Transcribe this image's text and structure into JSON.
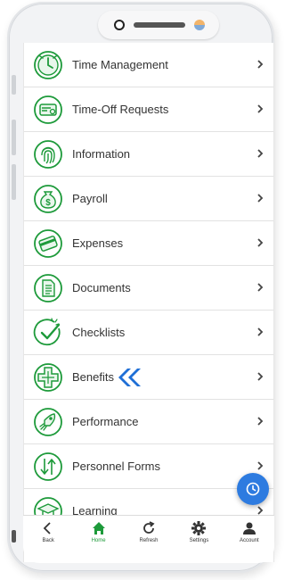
{
  "colors": {
    "accent_green": "#1d9a3a",
    "fab_blue": "#2d7be0",
    "marker_blue": "#1f6fd6"
  },
  "menu": {
    "items": [
      {
        "label": "Time Management",
        "icon": "clock-icon"
      },
      {
        "label": "Time-Off Requests",
        "icon": "ticket-icon"
      },
      {
        "label": "Information",
        "icon": "fingerprint-icon"
      },
      {
        "label": "Payroll",
        "icon": "money-bag-icon"
      },
      {
        "label": "Expenses",
        "icon": "credit-card-icon"
      },
      {
        "label": "Documents",
        "icon": "document-icon"
      },
      {
        "label": "Checklists",
        "icon": "checkmark-icon"
      },
      {
        "label": "Benefits",
        "icon": "medical-cross-icon"
      },
      {
        "label": "Performance",
        "icon": "rocket-icon"
      },
      {
        "label": "Personnel Forms",
        "icon": "arrows-icon"
      },
      {
        "label": "Learning",
        "icon": "graduation-icon"
      }
    ]
  },
  "fab": {
    "icon": "clock-icon"
  },
  "bottom_nav": {
    "items": [
      {
        "label": "Back",
        "icon": "chevron-left-icon"
      },
      {
        "label": "Home",
        "icon": "home-icon",
        "active": true
      },
      {
        "label": "Refresh",
        "icon": "refresh-icon"
      },
      {
        "label": "Settings",
        "icon": "gear-icon"
      },
      {
        "label": "Account",
        "icon": "user-icon"
      }
    ]
  }
}
